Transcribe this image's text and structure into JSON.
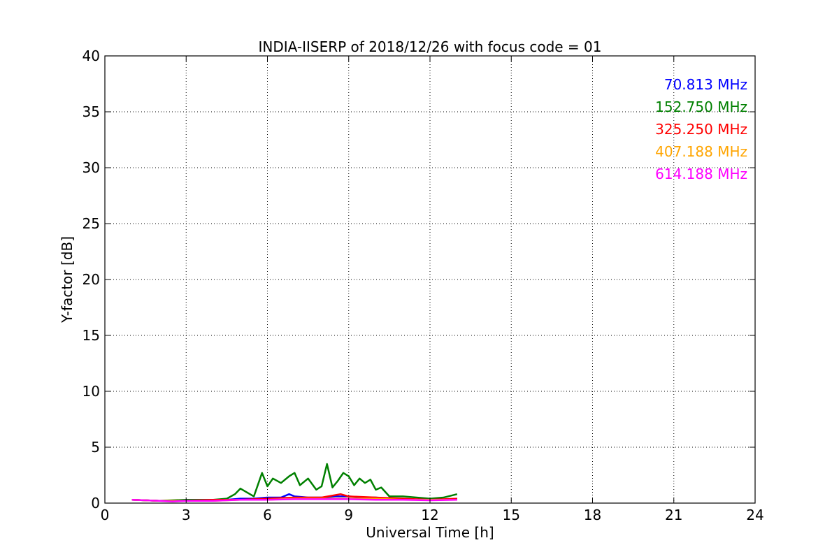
{
  "chart_data": {
    "type": "line",
    "title": "INDIA-IISERP of 2018/12/26 with focus code = 01",
    "xlabel": "Universal Time [h]",
    "ylabel": "Y-factor [dB]",
    "xlim": [
      0,
      24
    ],
    "ylim": [
      0,
      40
    ],
    "xticks": [
      "0",
      "3",
      "6",
      "9",
      "12",
      "15",
      "18",
      "21",
      "24"
    ],
    "yticks": [
      "0",
      "5",
      "10",
      "15",
      "20",
      "25",
      "30",
      "35",
      "40"
    ],
    "grid": true,
    "legend_placement": "top-right",
    "series": [
      {
        "name": "70.813 MHz",
        "color": "#0000ff",
        "x": [
          1.0,
          2.0,
          3.0,
          4.0,
          4.5,
          5.0,
          5.5,
          6.0,
          6.5,
          6.8,
          7.0,
          7.5,
          8.0,
          8.5,
          9.0,
          9.5,
          10.0,
          10.5,
          11.0,
          11.5,
          12.0,
          12.5,
          13.0
        ],
        "y": [
          0.3,
          0.2,
          0.2,
          0.3,
          0.3,
          0.4,
          0.4,
          0.5,
          0.5,
          0.8,
          0.6,
          0.5,
          0.5,
          0.6,
          0.6,
          0.5,
          0.5,
          0.4,
          0.4,
          0.3,
          0.3,
          0.3,
          0.4
        ]
      },
      {
        "name": "152.750 MHz",
        "color": "#008000",
        "x": [
          1.0,
          2.0,
          3.0,
          4.0,
          4.5,
          4.8,
          5.0,
          5.5,
          5.8,
          6.0,
          6.2,
          6.5,
          6.8,
          7.0,
          7.2,
          7.5,
          7.8,
          8.0,
          8.2,
          8.4,
          8.6,
          8.8,
          9.0,
          9.2,
          9.4,
          9.6,
          9.8,
          10.0,
          10.2,
          10.5,
          11.0,
          11.5,
          12.0,
          12.5,
          13.0
        ],
        "y": [
          0.3,
          0.2,
          0.3,
          0.3,
          0.4,
          0.8,
          1.3,
          0.6,
          2.7,
          1.5,
          2.2,
          1.8,
          2.4,
          2.7,
          1.6,
          2.2,
          1.2,
          1.5,
          3.5,
          1.4,
          2.0,
          2.7,
          2.4,
          1.6,
          2.2,
          1.8,
          2.1,
          1.2,
          1.4,
          0.6,
          0.6,
          0.5,
          0.4,
          0.5,
          0.8
        ]
      },
      {
        "name": "325.250 MHz",
        "color": "#ff0000",
        "x": [
          1.0,
          2.0,
          3.0,
          4.0,
          5.0,
          6.0,
          7.0,
          8.0,
          8.7,
          9.0,
          10.0,
          11.0,
          12.0,
          13.0
        ],
        "y": [
          0.3,
          0.2,
          0.2,
          0.3,
          0.3,
          0.4,
          0.5,
          0.5,
          0.8,
          0.6,
          0.5,
          0.4,
          0.3,
          0.4
        ]
      },
      {
        "name": "407.188 MHz",
        "color": "#ffa500",
        "x": [
          1.0,
          2.0,
          3.0,
          4.0,
          5.0,
          6.0,
          7.0,
          8.0,
          9.0,
          10.0,
          11.0,
          12.0,
          13.0
        ],
        "y": [
          0.3,
          0.2,
          0.2,
          0.2,
          0.3,
          0.3,
          0.4,
          0.4,
          0.4,
          0.4,
          0.3,
          0.3,
          0.3
        ]
      },
      {
        "name": "614.188 MHz",
        "color": "#ff00ff",
        "x": [
          1.0,
          1.5,
          2.0,
          2.5,
          3.0,
          4.0,
          5.0,
          6.0,
          7.0,
          8.0,
          9.0,
          10.0,
          11.0,
          12.0,
          13.0
        ],
        "y": [
          0.3,
          0.25,
          0.2,
          0.15,
          0.2,
          0.2,
          0.3,
          0.3,
          0.35,
          0.35,
          0.35,
          0.3,
          0.3,
          0.25,
          0.3
        ]
      }
    ]
  }
}
